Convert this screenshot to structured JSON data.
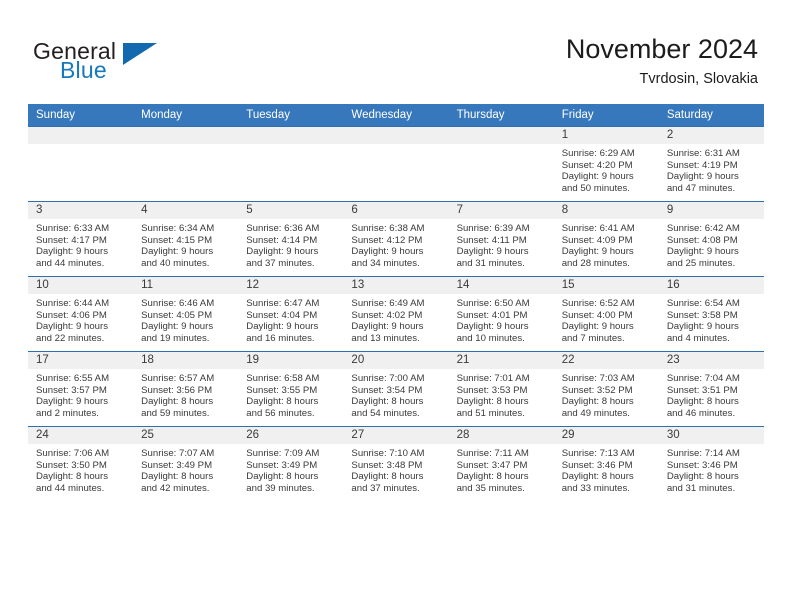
{
  "logo": {
    "word_top": "General",
    "word_bottom": "Blue",
    "triangle_color": "#1269b0",
    "text_color": "#231f20",
    "blue_color": "#1878be"
  },
  "header": {
    "month_title": "November 2024",
    "location": "Tvrdosin, Slovakia"
  },
  "theme": {
    "header_row_bg": "#3778bc",
    "header_row_text": "#ffffff",
    "daynum_band_bg": "#f0f0f0",
    "cell_border": "#2f6fb0",
    "body_text": "#3a3a3a"
  },
  "weekday_headers": [
    "Sunday",
    "Monday",
    "Tuesday",
    "Wednesday",
    "Thursday",
    "Friday",
    "Saturday"
  ],
  "weeks": [
    [
      {
        "day": "",
        "empty": true,
        "sunrise": "",
        "sunset": "",
        "daylight_line1": "",
        "daylight_line2": ""
      },
      {
        "day": "",
        "empty": true,
        "sunrise": "",
        "sunset": "",
        "daylight_line1": "",
        "daylight_line2": ""
      },
      {
        "day": "",
        "empty": true,
        "sunrise": "",
        "sunset": "",
        "daylight_line1": "",
        "daylight_line2": ""
      },
      {
        "day": "",
        "empty": true,
        "sunrise": "",
        "sunset": "",
        "daylight_line1": "",
        "daylight_line2": ""
      },
      {
        "day": "",
        "empty": true,
        "sunrise": "",
        "sunset": "",
        "daylight_line1": "",
        "daylight_line2": ""
      },
      {
        "day": "1",
        "empty": false,
        "sunrise": "Sunrise: 6:29 AM",
        "sunset": "Sunset: 4:20 PM",
        "daylight_line1": "Daylight: 9 hours",
        "daylight_line2": "and 50 minutes."
      },
      {
        "day": "2",
        "empty": false,
        "sunrise": "Sunrise: 6:31 AM",
        "sunset": "Sunset: 4:19 PM",
        "daylight_line1": "Daylight: 9 hours",
        "daylight_line2": "and 47 minutes."
      }
    ],
    [
      {
        "day": "3",
        "empty": false,
        "sunrise": "Sunrise: 6:33 AM",
        "sunset": "Sunset: 4:17 PM",
        "daylight_line1": "Daylight: 9 hours",
        "daylight_line2": "and 44 minutes."
      },
      {
        "day": "4",
        "empty": false,
        "sunrise": "Sunrise: 6:34 AM",
        "sunset": "Sunset: 4:15 PM",
        "daylight_line1": "Daylight: 9 hours",
        "daylight_line2": "and 40 minutes."
      },
      {
        "day": "5",
        "empty": false,
        "sunrise": "Sunrise: 6:36 AM",
        "sunset": "Sunset: 4:14 PM",
        "daylight_line1": "Daylight: 9 hours",
        "daylight_line2": "and 37 minutes."
      },
      {
        "day": "6",
        "empty": false,
        "sunrise": "Sunrise: 6:38 AM",
        "sunset": "Sunset: 4:12 PM",
        "daylight_line1": "Daylight: 9 hours",
        "daylight_line2": "and 34 minutes."
      },
      {
        "day": "7",
        "empty": false,
        "sunrise": "Sunrise: 6:39 AM",
        "sunset": "Sunset: 4:11 PM",
        "daylight_line1": "Daylight: 9 hours",
        "daylight_line2": "and 31 minutes."
      },
      {
        "day": "8",
        "empty": false,
        "sunrise": "Sunrise: 6:41 AM",
        "sunset": "Sunset: 4:09 PM",
        "daylight_line1": "Daylight: 9 hours",
        "daylight_line2": "and 28 minutes."
      },
      {
        "day": "9",
        "empty": false,
        "sunrise": "Sunrise: 6:42 AM",
        "sunset": "Sunset: 4:08 PM",
        "daylight_line1": "Daylight: 9 hours",
        "daylight_line2": "and 25 minutes."
      }
    ],
    [
      {
        "day": "10",
        "empty": false,
        "sunrise": "Sunrise: 6:44 AM",
        "sunset": "Sunset: 4:06 PM",
        "daylight_line1": "Daylight: 9 hours",
        "daylight_line2": "and 22 minutes."
      },
      {
        "day": "11",
        "empty": false,
        "sunrise": "Sunrise: 6:46 AM",
        "sunset": "Sunset: 4:05 PM",
        "daylight_line1": "Daylight: 9 hours",
        "daylight_line2": "and 19 minutes."
      },
      {
        "day": "12",
        "empty": false,
        "sunrise": "Sunrise: 6:47 AM",
        "sunset": "Sunset: 4:04 PM",
        "daylight_line1": "Daylight: 9 hours",
        "daylight_line2": "and 16 minutes."
      },
      {
        "day": "13",
        "empty": false,
        "sunrise": "Sunrise: 6:49 AM",
        "sunset": "Sunset: 4:02 PM",
        "daylight_line1": "Daylight: 9 hours",
        "daylight_line2": "and 13 minutes."
      },
      {
        "day": "14",
        "empty": false,
        "sunrise": "Sunrise: 6:50 AM",
        "sunset": "Sunset: 4:01 PM",
        "daylight_line1": "Daylight: 9 hours",
        "daylight_line2": "and 10 minutes."
      },
      {
        "day": "15",
        "empty": false,
        "sunrise": "Sunrise: 6:52 AM",
        "sunset": "Sunset: 4:00 PM",
        "daylight_line1": "Daylight: 9 hours",
        "daylight_line2": "and 7 minutes."
      },
      {
        "day": "16",
        "empty": false,
        "sunrise": "Sunrise: 6:54 AM",
        "sunset": "Sunset: 3:58 PM",
        "daylight_line1": "Daylight: 9 hours",
        "daylight_line2": "and 4 minutes."
      }
    ],
    [
      {
        "day": "17",
        "empty": false,
        "sunrise": "Sunrise: 6:55 AM",
        "sunset": "Sunset: 3:57 PM",
        "daylight_line1": "Daylight: 9 hours",
        "daylight_line2": "and 2 minutes."
      },
      {
        "day": "18",
        "empty": false,
        "sunrise": "Sunrise: 6:57 AM",
        "sunset": "Sunset: 3:56 PM",
        "daylight_line1": "Daylight: 8 hours",
        "daylight_line2": "and 59 minutes."
      },
      {
        "day": "19",
        "empty": false,
        "sunrise": "Sunrise: 6:58 AM",
        "sunset": "Sunset: 3:55 PM",
        "daylight_line1": "Daylight: 8 hours",
        "daylight_line2": "and 56 minutes."
      },
      {
        "day": "20",
        "empty": false,
        "sunrise": "Sunrise: 7:00 AM",
        "sunset": "Sunset: 3:54 PM",
        "daylight_line1": "Daylight: 8 hours",
        "daylight_line2": "and 54 minutes."
      },
      {
        "day": "21",
        "empty": false,
        "sunrise": "Sunrise: 7:01 AM",
        "sunset": "Sunset: 3:53 PM",
        "daylight_line1": "Daylight: 8 hours",
        "daylight_line2": "and 51 minutes."
      },
      {
        "day": "22",
        "empty": false,
        "sunrise": "Sunrise: 7:03 AM",
        "sunset": "Sunset: 3:52 PM",
        "daylight_line1": "Daylight: 8 hours",
        "daylight_line2": "and 49 minutes."
      },
      {
        "day": "23",
        "empty": false,
        "sunrise": "Sunrise: 7:04 AM",
        "sunset": "Sunset: 3:51 PM",
        "daylight_line1": "Daylight: 8 hours",
        "daylight_line2": "and 46 minutes."
      }
    ],
    [
      {
        "day": "24",
        "empty": false,
        "sunrise": "Sunrise: 7:06 AM",
        "sunset": "Sunset: 3:50 PM",
        "daylight_line1": "Daylight: 8 hours",
        "daylight_line2": "and 44 minutes."
      },
      {
        "day": "25",
        "empty": false,
        "sunrise": "Sunrise: 7:07 AM",
        "sunset": "Sunset: 3:49 PM",
        "daylight_line1": "Daylight: 8 hours",
        "daylight_line2": "and 42 minutes."
      },
      {
        "day": "26",
        "empty": false,
        "sunrise": "Sunrise: 7:09 AM",
        "sunset": "Sunset: 3:49 PM",
        "daylight_line1": "Daylight: 8 hours",
        "daylight_line2": "and 39 minutes."
      },
      {
        "day": "27",
        "empty": false,
        "sunrise": "Sunrise: 7:10 AM",
        "sunset": "Sunset: 3:48 PM",
        "daylight_line1": "Daylight: 8 hours",
        "daylight_line2": "and 37 minutes."
      },
      {
        "day": "28",
        "empty": false,
        "sunrise": "Sunrise: 7:11 AM",
        "sunset": "Sunset: 3:47 PM",
        "daylight_line1": "Daylight: 8 hours",
        "daylight_line2": "and 35 minutes."
      },
      {
        "day": "29",
        "empty": false,
        "sunrise": "Sunrise: 7:13 AM",
        "sunset": "Sunset: 3:46 PM",
        "daylight_line1": "Daylight: 8 hours",
        "daylight_line2": "and 33 minutes."
      },
      {
        "day": "30",
        "empty": false,
        "sunrise": "Sunrise: 7:14 AM",
        "sunset": "Sunset: 3:46 PM",
        "daylight_line1": "Daylight: 8 hours",
        "daylight_line2": "and 31 minutes."
      }
    ]
  ]
}
